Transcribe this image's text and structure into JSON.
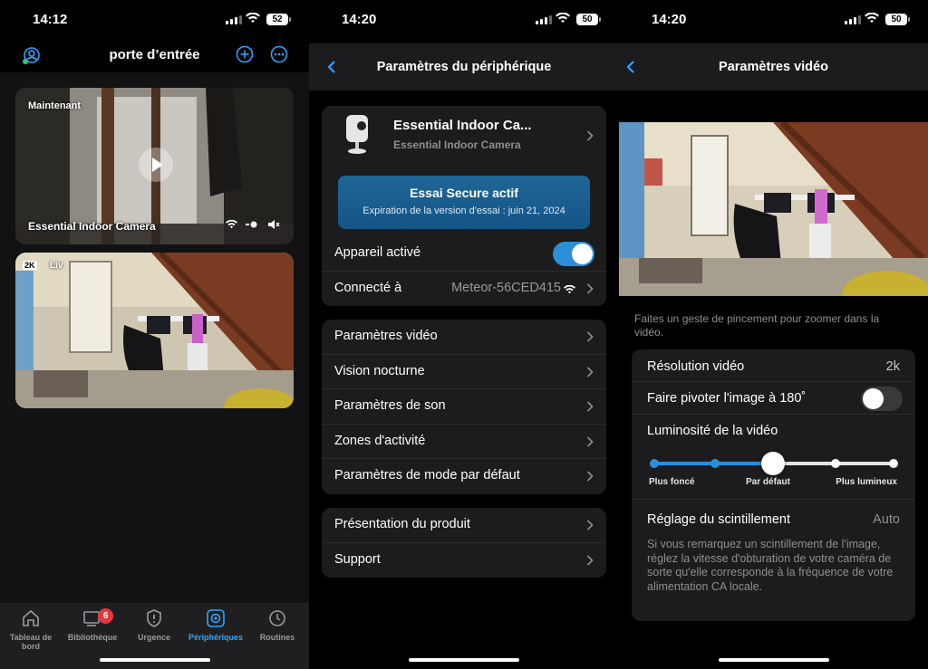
{
  "screen1": {
    "status": {
      "time": "14:12",
      "battery": "52"
    },
    "header": {
      "title": "porte d’entrée"
    },
    "cards": [
      {
        "time_label": "Maintenant",
        "camera_name": "Essential Indoor Camera"
      },
      {
        "quality_label": "2K",
        "live_label": "Liv"
      }
    ],
    "tabbar": {
      "tabs": [
        {
          "label": "Tableau de bord",
          "icon": "home-icon"
        },
        {
          "label": "Bibliothèque",
          "icon": "library-icon",
          "badge": "6"
        },
        {
          "label": "Urgence",
          "icon": "shield-icon"
        },
        {
          "label": "Périphériques",
          "icon": "camera-icon",
          "active": true
        },
        {
          "label": "Routines",
          "icon": "routine-icon"
        }
      ]
    }
  },
  "screen2": {
    "status": {
      "time": "14:20",
      "battery": "50"
    },
    "nav": {
      "title": "Paramètres du périphérique"
    },
    "device": {
      "name": "Essential Indoor Ca...",
      "model": "Essential Indoor Camera"
    },
    "trial": {
      "title": "Essai Secure actif",
      "subtitle": "Expiration de la version d'essai : juin 21, 2024"
    },
    "enabled_label": "Appareil activé",
    "connected": {
      "label": "Connecté à",
      "value": "Meteor-56CED415"
    },
    "menu1": [
      "Paramètres vidéo",
      "Vision nocturne",
      "Paramètres de son",
      "Zones d'activité",
      "Paramètres de mode par défaut"
    ],
    "menu2": [
      "Présentation du produit",
      "Support"
    ]
  },
  "screen3": {
    "status": {
      "time": "14:20",
      "battery": "50"
    },
    "nav": {
      "title": "Paramètres vidéo"
    },
    "hint": "Faites un geste de pincement pour zoomer dans la vidéo.",
    "resolution": {
      "label": "Résolution vidéo",
      "value": "2k"
    },
    "rotate_label": "Faire pivoter l'image à 180˚",
    "brightness": {
      "label": "Luminosité de la vidéo",
      "level": 0.5,
      "left": "Plus foncé",
      "center": "Par défaut",
      "right": "Plus lumineux"
    },
    "flicker": {
      "label": "Réglage du scintillement",
      "value": "Auto",
      "note": "Si vous remarquez un scintillement de l'image, réglez la vitesse d'obturation de votre caméra de sorte qu'elle corresponde à la fréquence de votre alimentation CA locale."
    }
  },
  "colors": {
    "accent": "#2b8fd8",
    "card": "#1c1c1e",
    "badge": "#e0393e"
  }
}
